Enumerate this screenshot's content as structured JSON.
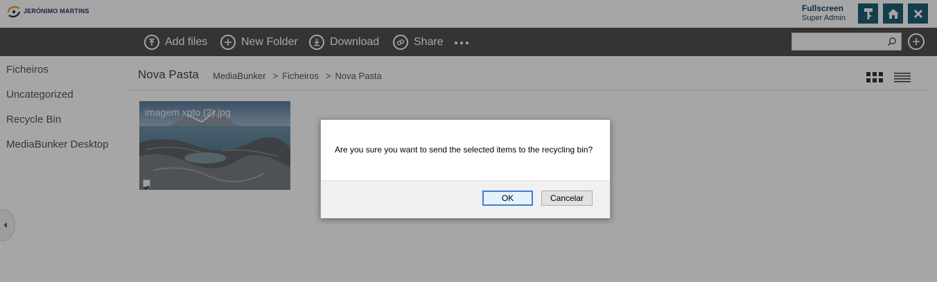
{
  "header": {
    "logo_text": "JERÓNIMO MARTINS",
    "fullscreen_label": "Fullscreen",
    "role": "Super Admin",
    "buttons": [
      {
        "icon": "key-icon"
      },
      {
        "icon": "home-icon"
      },
      {
        "icon": "close-icon"
      }
    ]
  },
  "toolbar": {
    "add_files": "Add files",
    "new_folder": "New Folder",
    "download": "Download",
    "share": "Share",
    "search_placeholder": ""
  },
  "sidebar": {
    "items": [
      {
        "label": "Ficheiros"
      },
      {
        "label": "Uncategorized"
      },
      {
        "label": "Recycle Bin"
      },
      {
        "label": "MediaBunker Desktop"
      }
    ]
  },
  "main": {
    "folder_title": "Nova Pasta",
    "breadcrumb": [
      "MediaBunker",
      "Ficheiros",
      "Nova Pasta"
    ],
    "breadcrumb_sep": ">",
    "file": {
      "name": "imagem xpto (2).jpg",
      "selected": true
    }
  },
  "dialog": {
    "message": "Are you sure you want to send the selected items to the recycling bin?",
    "ok_label": "OK",
    "cancel_label": "Cancelar"
  },
  "colors": {
    "toolbar_bg": "#505050",
    "header_button_bg": "#1f5f79",
    "brand_navy": "#27346a",
    "focus_blue": "#3c7fd1"
  }
}
